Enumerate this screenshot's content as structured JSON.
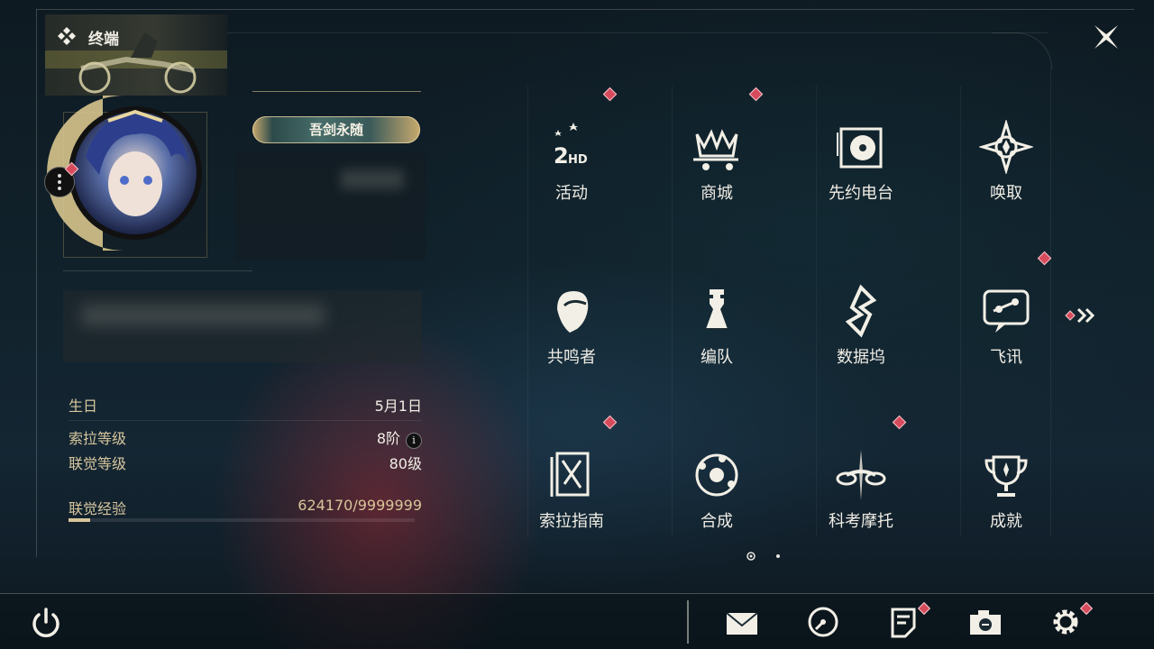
{
  "header": {
    "title": "终端"
  },
  "profile": {
    "title_badge": "吾剑永随",
    "stats": [
      {
        "label": "生日",
        "value": "5月1日"
      },
      {
        "label": "索拉等级",
        "value": "8阶"
      },
      {
        "label": "联觉等级",
        "value": "80级"
      }
    ],
    "exp": {
      "label": "联觉经验",
      "value": "624170/9999999",
      "progress": 0.0624
    }
  },
  "menu": {
    "items": [
      {
        "label": "活动",
        "icon": "event-2hd-icon",
        "badge": true
      },
      {
        "label": "商城",
        "icon": "shop-crown-cart-icon",
        "badge": true
      },
      {
        "label": "先约电台",
        "icon": "radio-vinyl-icon",
        "badge": false
      },
      {
        "label": "唤取",
        "icon": "convene-star-icon",
        "badge": false
      },
      {
        "label": "共鸣者",
        "icon": "resonator-portrait-icon",
        "badge": false
      },
      {
        "label": "编队",
        "icon": "team-chess-icon",
        "badge": false
      },
      {
        "label": "数据坞",
        "icon": "data-bank-icon",
        "badge": false
      },
      {
        "label": "飞讯",
        "icon": "chat-bubble-icon",
        "badge": true
      },
      {
        "label": "索拉指南",
        "icon": "guide-book-icon",
        "badge": true
      },
      {
        "label": "合成",
        "icon": "synthesis-orbit-icon",
        "badge": false
      },
      {
        "label": "科考摩托",
        "icon": "motorcycle-icon",
        "badge": true
      },
      {
        "label": "成就",
        "icon": "trophy-icon",
        "badge": false
      }
    ]
  },
  "bottom_bar": {
    "icons": [
      "power-icon",
      "mail-icon",
      "clock-icon",
      "notes-icon",
      "camera-icon",
      "settings-gear-icon"
    ]
  },
  "colors": {
    "accent_gold": "#d8c59a",
    "badge_red": "#d64b5c",
    "text_light": "#f0ede5"
  }
}
